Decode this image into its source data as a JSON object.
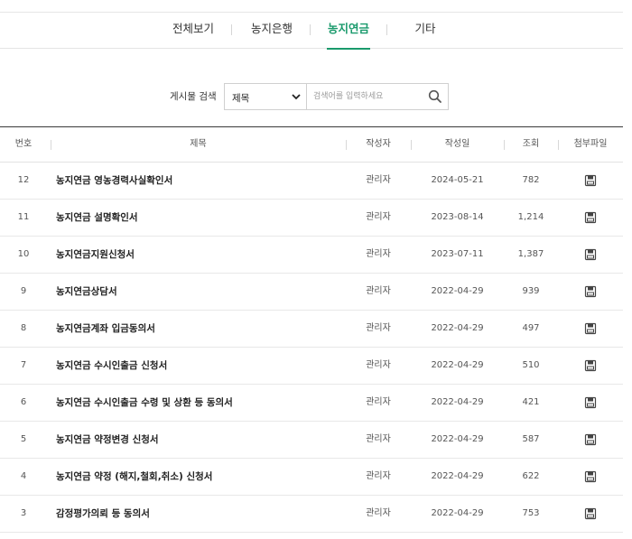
{
  "tabs": [
    {
      "label": "전체보기",
      "active": false
    },
    {
      "label": "농지은행",
      "active": false
    },
    {
      "label": "농지연금",
      "active": true
    },
    {
      "label": "기타",
      "active": false
    }
  ],
  "search": {
    "label": "게시물 검색",
    "selected": "제목",
    "placeholder": "검색어를 입력하세요",
    "button_icon": "search-icon"
  },
  "table": {
    "headers": [
      "번호",
      "제목",
      "작성자",
      "작성일",
      "조회",
      "첨부파일"
    ],
    "rows": [
      {
        "no": "12",
        "title": "농지연금 영농경력사실확인서",
        "author": "관리자",
        "date": "2024-05-21",
        "views": "782",
        "attachment": "file-icon"
      },
      {
        "no": "11",
        "title": "농지연금 설명확인서",
        "author": "관리자",
        "date": "2023-08-14",
        "views": "1,214",
        "attachment": "file-icon"
      },
      {
        "no": "10",
        "title": "농지연금지원신청서",
        "author": "관리자",
        "date": "2023-07-11",
        "views": "1,387",
        "attachment": "file-icon"
      },
      {
        "no": "9",
        "title": "농지연금상담서",
        "author": "관리자",
        "date": "2022-04-29",
        "views": "939",
        "attachment": "file-icon"
      },
      {
        "no": "8",
        "title": "농지연금계좌 입금동의서",
        "author": "관리자",
        "date": "2022-04-29",
        "views": "497",
        "attachment": "file-icon"
      },
      {
        "no": "7",
        "title": "농지연금 수시인출금 신청서",
        "author": "관리자",
        "date": "2022-04-29",
        "views": "510",
        "attachment": "file-icon"
      },
      {
        "no": "6",
        "title": "농지연금 수시인출금 수령 및 상환 등 동의서",
        "author": "관리자",
        "date": "2022-04-29",
        "views": "421",
        "attachment": "file-icon"
      },
      {
        "no": "5",
        "title": "농지연금 약정변경 신청서",
        "author": "관리자",
        "date": "2022-04-29",
        "views": "587",
        "attachment": "file-icon"
      },
      {
        "no": "4",
        "title": "농지연금 약정 (해지,철회,취소) 신청서",
        "author": "관리자",
        "date": "2022-04-29",
        "views": "622",
        "attachment": "file-icon"
      },
      {
        "no": "3",
        "title": "감정평가의뢰 등 동의서",
        "author": "관리자",
        "date": "2022-04-29",
        "views": "753",
        "attachment": "file-icon"
      }
    ]
  },
  "colors": {
    "accent": "#1a9a6c",
    "header_border": "#3a3a3a"
  }
}
